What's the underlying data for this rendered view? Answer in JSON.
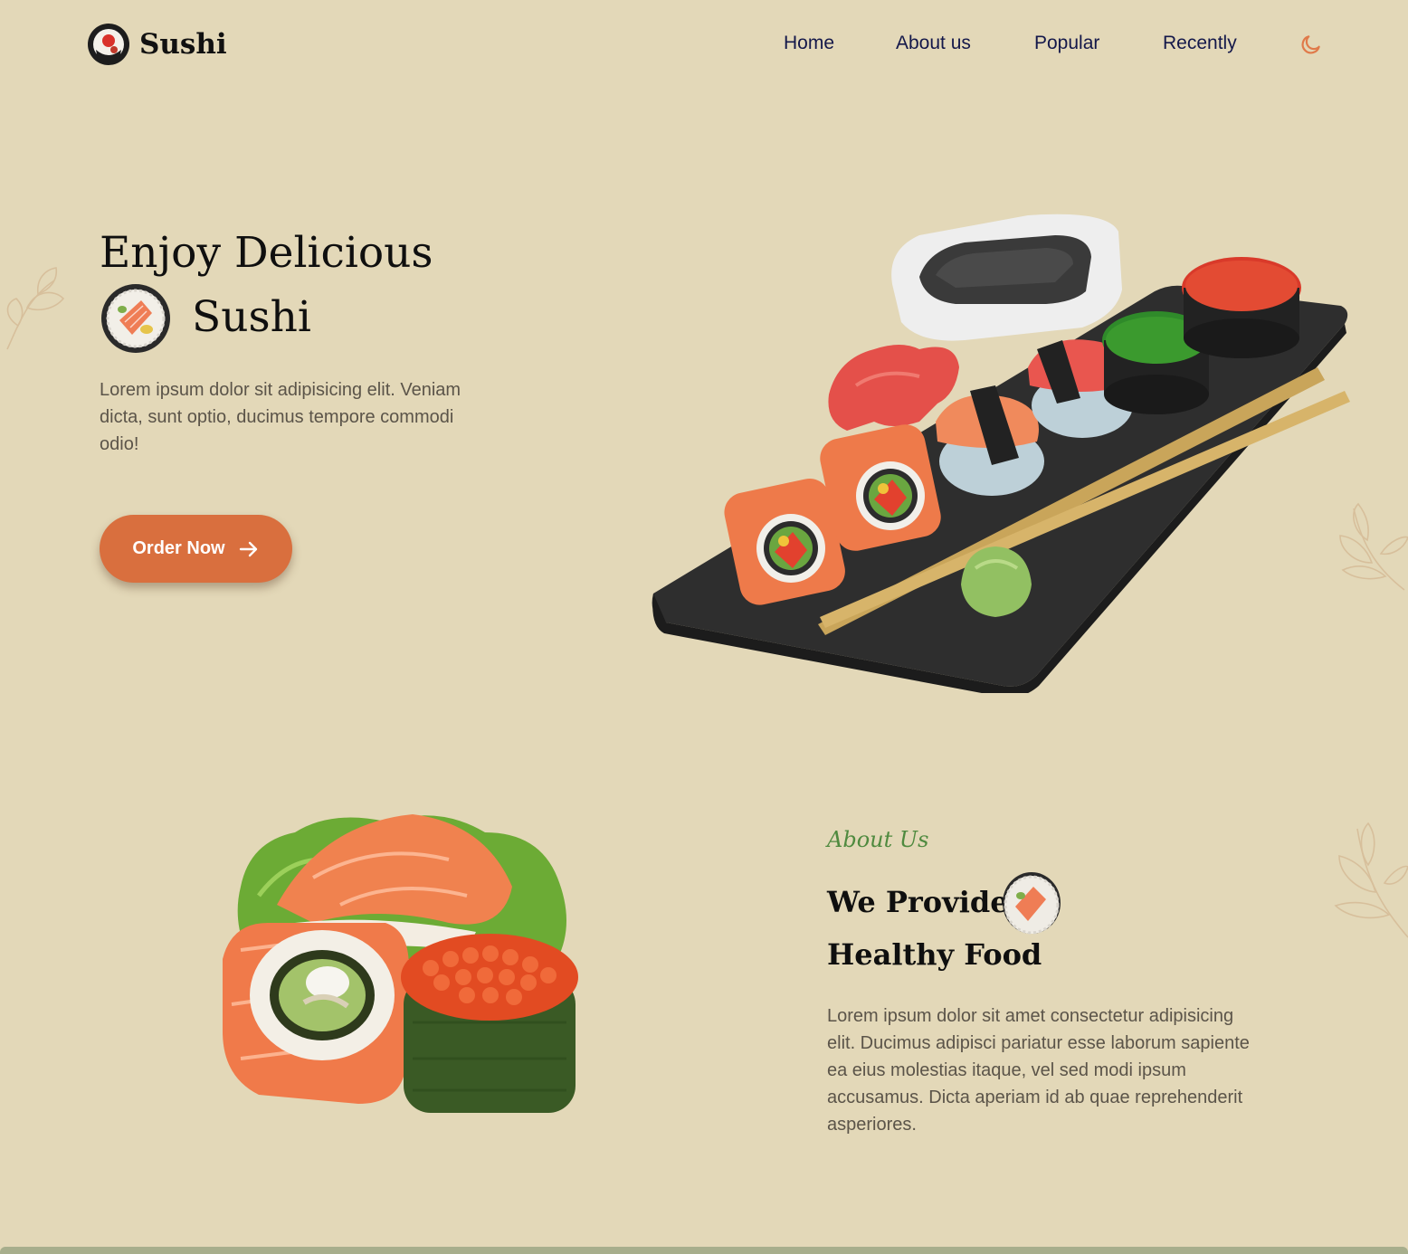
{
  "brand": {
    "name": "Sushi"
  },
  "nav": {
    "home": "Home",
    "about": "About us",
    "popular": "Popular",
    "recently": "Recently"
  },
  "theme_toggle": {
    "icon": "moon-icon",
    "color": "#e07a4a"
  },
  "hero": {
    "title_line1": "Enjoy Delicious",
    "title_line2": "Sushi",
    "description": "Lorem ipsum dolor sit adipisicing elit. Veniam dicta, sunt optio, ducimus tempore commodi odio!",
    "button_label": "Order Now",
    "button_icon": "arrow-right-icon"
  },
  "about": {
    "tag": "About Us",
    "title_line1": "We Provide",
    "title_line2": "Healthy Food",
    "description": "Lorem ipsum dolor sit amet consectetur adipisicing elit. Ducimus adipisci pariatur esse laborum sapiente ea eius molestias itaque, vel sed modi ipsum accusamus. Dicta aperiam id ab quae reprehenderit asperiores."
  },
  "colors": {
    "background": "#e3d8b8",
    "accent": "#d96f3e",
    "nav_text": "#14184a",
    "tag_green": "#4f8a3f",
    "body_text": "#5b5449"
  }
}
